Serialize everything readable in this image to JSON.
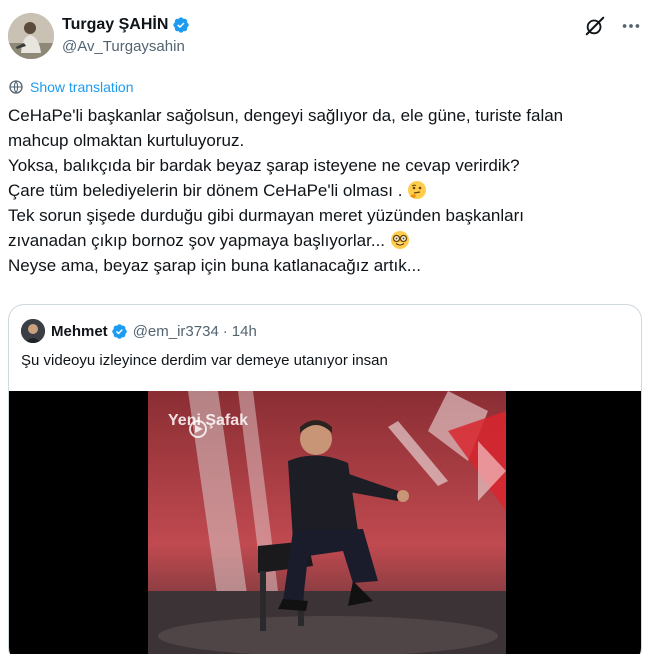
{
  "author": {
    "name": "Turgay ŞAHİN",
    "handle": "@Av_Turgaysahin",
    "verified": true
  },
  "top_icons": [
    "grok-icon",
    "more-icon"
  ],
  "translation": {
    "label": "Show translation"
  },
  "tweet": {
    "lines": [
      "CeHaPe'li başkanlar sağolsun, dengeyi sağlıyor da, ele güne, turiste falan",
      "mahcup olmaktan kurtuluyoruz.",
      "Yoksa, balıkçıda bir bardak beyaz şarap isteyene ne cevap verirdik?",
      "Çare tüm belediyelerin bir dönem CeHaPe'li olması .",
      "Tek sorun şişede durduğu gibi durmayan meret yüzünden başkanları",
      "zıvanadan çıkıp bornoz şov yapmaya başlıyorlar...",
      "Neyse ama, beyaz şarap için buna katlanacağız artık..."
    ],
    "emojis": [
      "thinking-face-emoji",
      "nerd-face-emoji"
    ]
  },
  "quote": {
    "name": "Mehmet",
    "handle": "@em_ir3734",
    "separator": "·",
    "time": "14h",
    "verified": true,
    "text": "Şu videoyu izleyince derdim var demeye utanıyor insan",
    "video": {
      "channel_logo": "Yeni Şafak"
    }
  },
  "colors": {
    "accent": "#1d9bf0",
    "text": "#0f1419",
    "secondary": "#536471",
    "border": "#cfd9de"
  }
}
